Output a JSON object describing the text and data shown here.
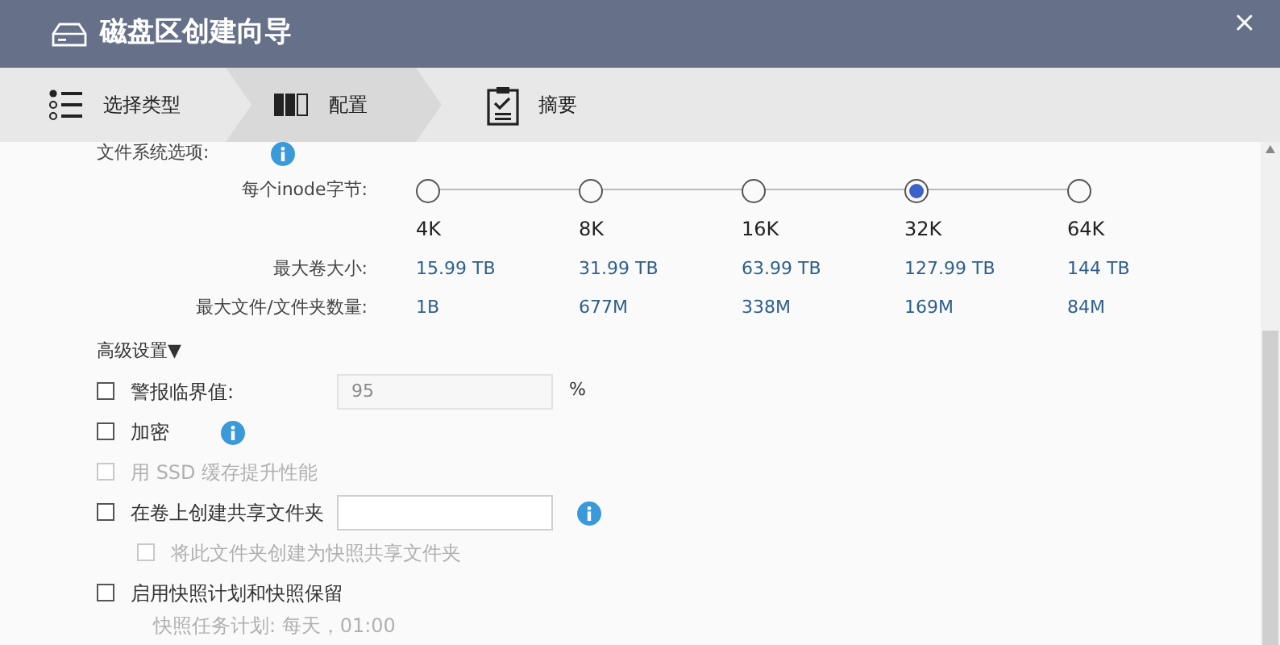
{
  "window": {
    "title": "磁盘区创建向导"
  },
  "steps": [
    {
      "label": "选择类型",
      "kind": "list",
      "selected": false
    },
    {
      "label": "配置",
      "kind": "disks",
      "selected": true
    },
    {
      "label": "摘要",
      "kind": "clipboard",
      "selected": false
    }
  ],
  "filesystem": {
    "label": "文件系统选项:",
    "info": true
  },
  "inode": {
    "label": "每个inode字节:",
    "options": [
      {
        "label": "4K",
        "selected": false
      },
      {
        "label": "8K",
        "selected": false
      },
      {
        "label": "16K",
        "selected": false
      },
      {
        "label": "32K",
        "selected": true
      },
      {
        "label": "64K",
        "selected": false
      }
    ]
  },
  "stats": [
    {
      "label": "最大卷大小:",
      "values": [
        "15.99 TB",
        "31.99 TB",
        "63.99 TB",
        "127.99 TB",
        "144 TB"
      ]
    },
    {
      "label": "最大文件/文件夹数量:",
      "values": [
        "1B",
        "677M",
        "338M",
        "169M",
        "84M"
      ]
    }
  ],
  "advanced": {
    "label": "高级设置▼"
  },
  "options": [
    {
      "kind": "checkbox",
      "label": "警报临界值:",
      "checked": false,
      "disabled": false,
      "field": {
        "value": "95",
        "disabled": true
      },
      "suffix": "%"
    },
    {
      "kind": "checkbox",
      "label": "加密",
      "checked": false,
      "disabled": false,
      "info": true
    },
    {
      "kind": "checkbox",
      "label": "用 SSD 缓存提升性能",
      "checked": false,
      "disabled": true
    },
    {
      "kind": "checkbox",
      "label": "在卷上创建共享文件夹",
      "checked": false,
      "disabled": false,
      "field": {
        "disabled": false
      },
      "info": true,
      "children": [
        {
          "kind": "checkbox",
          "label": "将此文件夹创建为快照共享文件夹",
          "checked": false,
          "disabled": true
        }
      ]
    },
    {
      "kind": "checkbox",
      "label": "启用快照计划和快照保留",
      "checked": false,
      "disabled": false,
      "children": [
        {
          "kind": "text",
          "label": "快照任务计划: 每天，01:00",
          "disabled": true
        }
      ]
    }
  ]
}
